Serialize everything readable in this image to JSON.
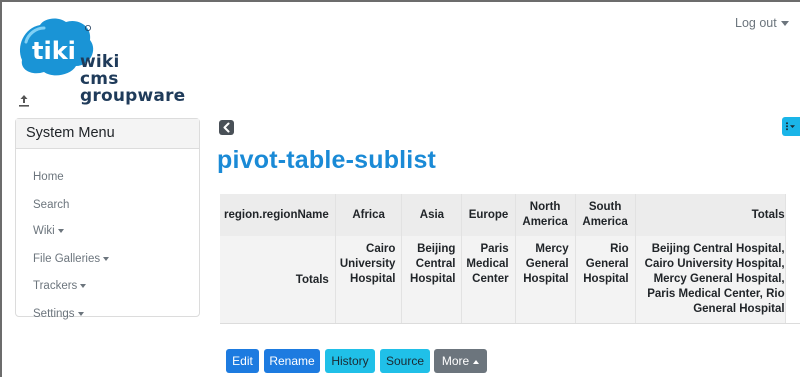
{
  "logo": {
    "line1": "wiki",
    "line2": "cms",
    "line3": "groupware",
    "brand": "tiki"
  },
  "header": {
    "logout_label": "Log out"
  },
  "sidebar": {
    "title": "System Menu",
    "items": [
      {
        "label": "Home",
        "has_caret": false
      },
      {
        "label": "Search",
        "has_caret": false
      },
      {
        "label": "Wiki",
        "has_caret": true
      },
      {
        "label": "File Galleries",
        "has_caret": true
      },
      {
        "label": "Trackers",
        "has_caret": true
      },
      {
        "label": "Settings",
        "has_caret": true
      }
    ]
  },
  "page": {
    "title": "pivot-table-sublist"
  },
  "pivot": {
    "header": {
      "region": "region.regionName",
      "africa": "Africa",
      "asia": "Asia",
      "europe": "Europe",
      "north_america_1": "North",
      "north_america_2": "America",
      "south_america_1": "South",
      "south_america_2": "America",
      "totals": "Totals"
    },
    "row": {
      "label": "Totals",
      "africa": [
        "Cairo",
        "University",
        "Hospital"
      ],
      "asia": [
        "Beijing",
        "Central",
        "Hospital"
      ],
      "europe": [
        "Paris",
        "Medical",
        "Center"
      ],
      "north_america": [
        "Mercy",
        "General",
        "Hospital"
      ],
      "south_america": [
        "Rio",
        "General",
        "Hospital"
      ],
      "totals": [
        "Beijing Central Hospital,",
        "Cairo University Hospital,",
        "Mercy General Hospital,",
        "Paris Medical Center, Rio",
        "General Hospital"
      ]
    }
  },
  "actions": {
    "edit": "Edit",
    "rename": "Rename",
    "history": "History",
    "source": "Source",
    "more": "More"
  },
  "colors": {
    "title": "#1a8ad6",
    "primary_button": "#1d7be0",
    "info_button": "#20c0e8",
    "secondary_button": "#6c757d",
    "page_actions": "#1ab5e8"
  },
  "icons": {
    "back": "chevron-left-icon",
    "page_actions": "kebab-dropdown-icon",
    "upload": "upload-icon"
  }
}
